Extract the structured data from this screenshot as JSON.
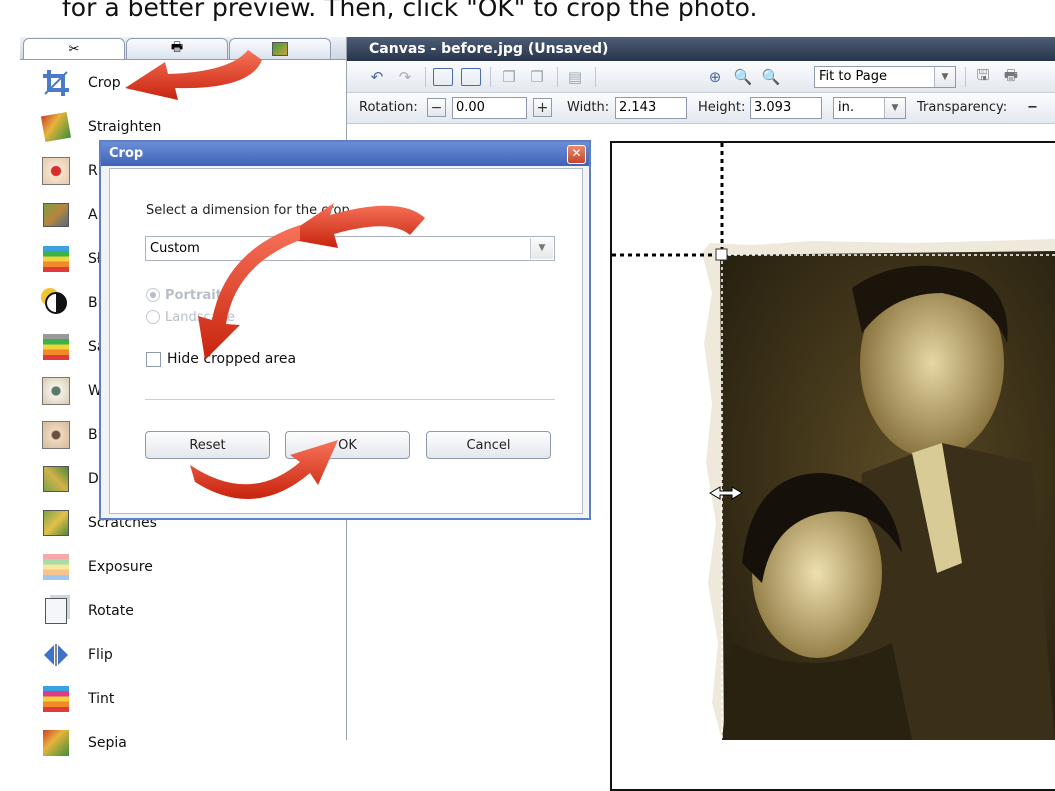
{
  "instruction": "for a better preview. Then, click \"OK\" to crop the photo.",
  "left_panel": {
    "tabs": [
      {
        "icon": "tools-icon"
      },
      {
        "icon": "printer-icon"
      },
      {
        "icon": "image-icon"
      }
    ],
    "tools": [
      {
        "label": "Crop",
        "icon": "crop-icon"
      },
      {
        "label": "Straighten",
        "icon": "straighten-icon"
      },
      {
        "label": "R",
        "icon": "red-eye-icon"
      },
      {
        "label": "A",
        "icon": "adjust-icon"
      },
      {
        "label": "Sł",
        "icon": "sharpen-icon"
      },
      {
        "label": "Bı",
        "icon": "brightness-icon"
      },
      {
        "label": "Sa",
        "icon": "saturation-icon"
      },
      {
        "label": "W",
        "icon": "whiten-icon"
      },
      {
        "label": "Bl",
        "icon": "blemish-icon"
      },
      {
        "label": "D",
        "icon": "dust-icon"
      },
      {
        "label": "Scratches",
        "icon": "scratches-icon"
      },
      {
        "label": "Exposure",
        "icon": "exposure-icon"
      },
      {
        "label": "Rotate",
        "icon": "rotate-icon"
      },
      {
        "label": "Flip",
        "icon": "flip-icon"
      },
      {
        "label": "Tint",
        "icon": "tint-icon"
      },
      {
        "label": "Sepia",
        "icon": "sepia-icon"
      }
    ]
  },
  "canvas": {
    "title": "Canvas - before.jpg (Unsaved)",
    "zoom": "Fit to Page",
    "rotation_label": "Rotation:",
    "rotation_value": "0.00",
    "width_label": "Width:",
    "width_value": "2.143",
    "height_label": "Height:",
    "height_value": "3.093",
    "unit": "in.",
    "transparency_label": "Transparency:"
  },
  "dialog": {
    "title": "Crop",
    "close_glyph": "✕",
    "prompt": "Select a dimension for the crop",
    "dimension_value": "Custom",
    "portrait_label": "Portrait",
    "landscape_label": "Landscape",
    "hide_label": "Hide cropped area",
    "reset_label": "Reset",
    "ok_label": "OK",
    "cancel_label": "Cancel"
  },
  "colors": {
    "dialog_border": "#5c7fc8",
    "canvas_title": "#27344b",
    "arrow": "#e53b1f"
  }
}
